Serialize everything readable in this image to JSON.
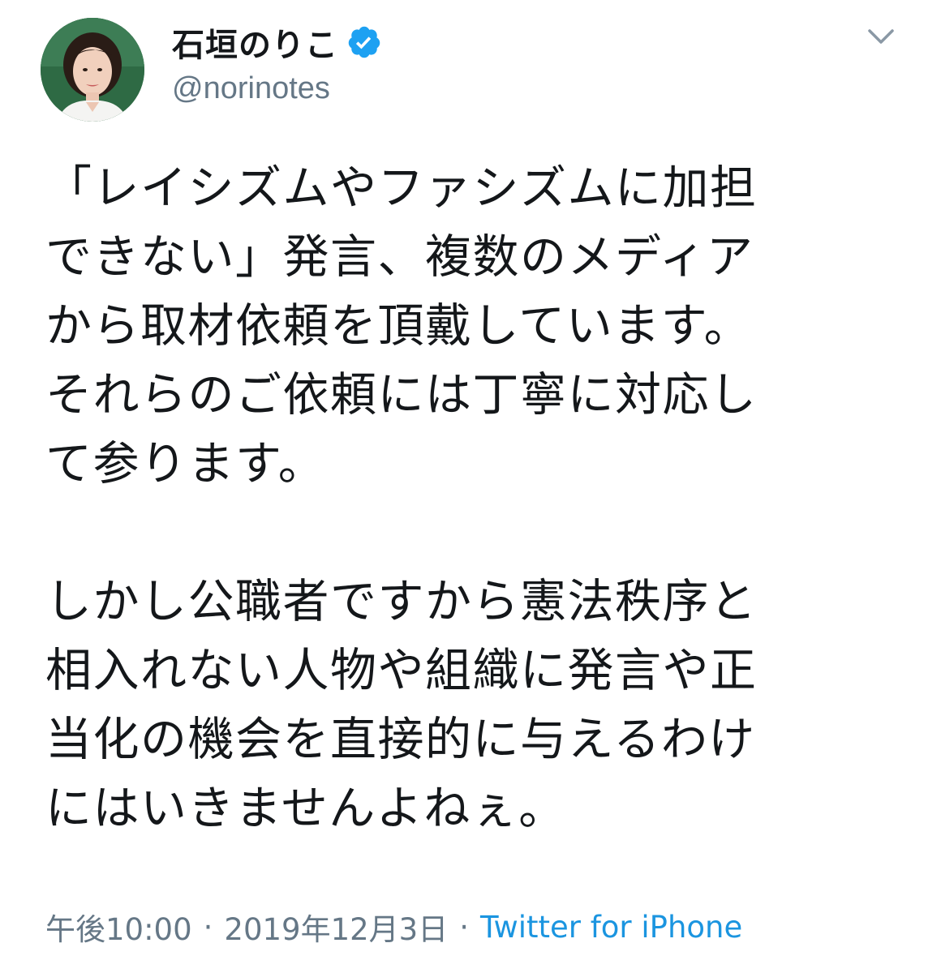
{
  "tweet": {
    "author": {
      "display_name": "石垣のりこ",
      "handle": "@norinotes",
      "verified": true,
      "avatar_icon": "profile-photo"
    },
    "text_lines": [
      "「レイシズムやファシズムに加担",
      "できない」発言、複数のメディア",
      "から取材依頼を頂戴しています。",
      "それらのご依頼には丁寧に対応し",
      "て参ります。",
      "",
      "しかし公職者ですから憲法秩序と",
      "相入れない人物や組織に発言や正",
      "当化の機会を直接的に与えるわけ",
      "にはいきませんよねぇ。"
    ],
    "time": "午後10:00",
    "date": "2019年12月3日",
    "separator": "·",
    "source": "Twitter for iPhone"
  },
  "colors": {
    "text": "#14171a",
    "secondary": "#657786",
    "link": "#1b95e0",
    "verified": "#1da1f2"
  },
  "icons": {
    "verified": "verified-badge-icon",
    "more": "chevron-down-icon"
  }
}
